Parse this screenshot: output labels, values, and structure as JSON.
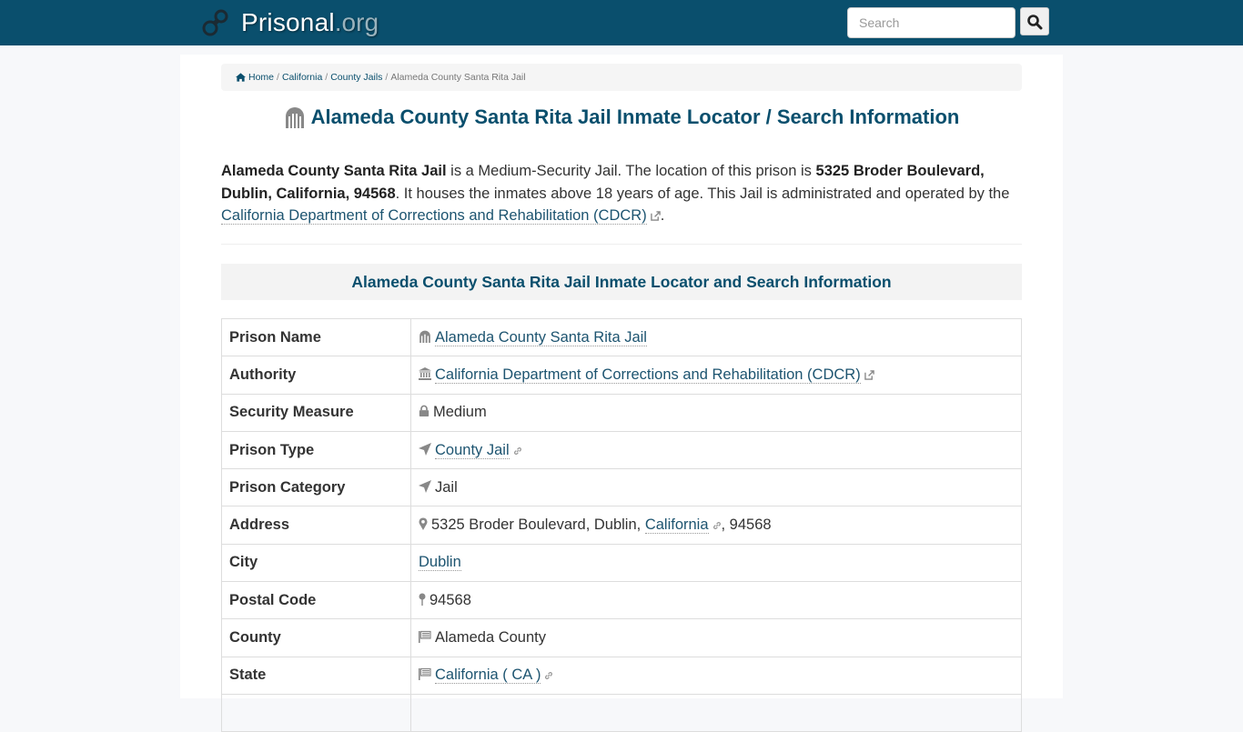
{
  "header": {
    "brand_name": "Prisonal",
    "brand_tld": ".org",
    "search_placeholder": "Search",
    "colors": {
      "navbar": "#0a4f6d",
      "link": "#1d5470"
    }
  },
  "breadcrumb": {
    "items": [
      "Home",
      "California",
      "County Jails"
    ],
    "current": "Alameda County Santa Rita Jail",
    "separator": "/"
  },
  "page": {
    "title": "Alameda County Santa Rita Jail Inmate Locator / Search Information",
    "intro": {
      "name": "Alameda County Santa Rita Jail",
      "text1": " is a Medium-Security Jail. The location of this prison is ",
      "address": "5325 Broder Boulevard, Dublin, California, 94568",
      "text2": ". It houses the inmates above 18 years of age. This Jail is administrated and operated by the ",
      "authority_link": "California Department of Corrections and Rehabilitation (CDCR)",
      "text3": "."
    },
    "section_heading": "Alameda County Santa Rita Jail Inmate Locator and Search Information"
  },
  "table": {
    "rows": [
      {
        "label": "Prison Name",
        "value": "Alameda County Santa Rita Jail",
        "icon": "prison-icon"
      },
      {
        "label": "Authority",
        "value": "California Department of Corrections and Rehabilitation (CDCR)",
        "icon": "institution-icon"
      },
      {
        "label": "Security Measure",
        "value": "Medium",
        "icon": "lock-icon"
      },
      {
        "label": "Prison Type",
        "value": "County Jail",
        "icon": "location-arrow-icon"
      },
      {
        "label": "Prison Category",
        "value": "Jail",
        "icon": "location-arrow-icon"
      },
      {
        "label": "Address",
        "street": "5325 Broder Boulevard, Dublin, ",
        "state_link": "California",
        "zip": ", 94568",
        "icon": "map-marker-icon"
      },
      {
        "label": "City",
        "value": "Dublin"
      },
      {
        "label": "Postal Code",
        "value": "94568",
        "icon": "map-pin-icon"
      },
      {
        "label": "County",
        "value": "Alameda County",
        "icon": "flag-icon"
      },
      {
        "label": "State",
        "value": "California ( CA )",
        "icon": "flag-icon"
      }
    ]
  }
}
